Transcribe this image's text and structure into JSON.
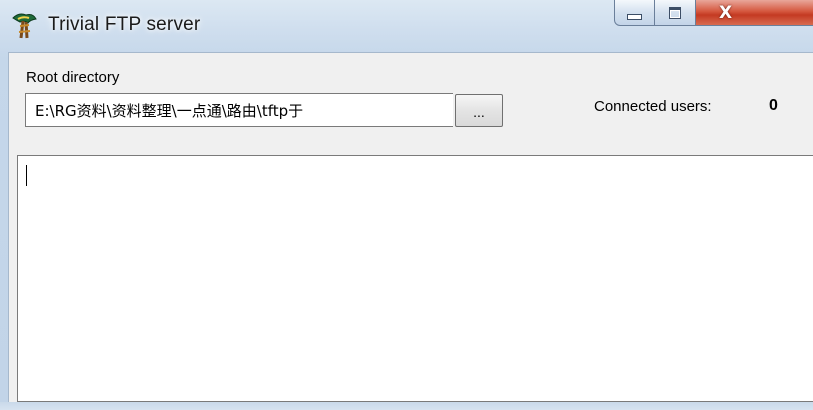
{
  "window": {
    "title": "Trivial FTP server",
    "icon": "tftp-app-icon",
    "controls": {
      "minimize": "minimize-icon",
      "maximize": "maximize-icon",
      "close_glyph": "X"
    }
  },
  "root_directory": {
    "label": "Root directory",
    "value": "E:\\RG资料\\资料整理\\一点通\\路由\\tftp于",
    "browse_label": "..."
  },
  "connections": {
    "label": "Connected users:",
    "count": "0"
  },
  "log": {
    "text": ""
  },
  "colors": {
    "close_button": "#d5583f",
    "frame": "#c5d7ea",
    "client": "#f0f0f0"
  }
}
